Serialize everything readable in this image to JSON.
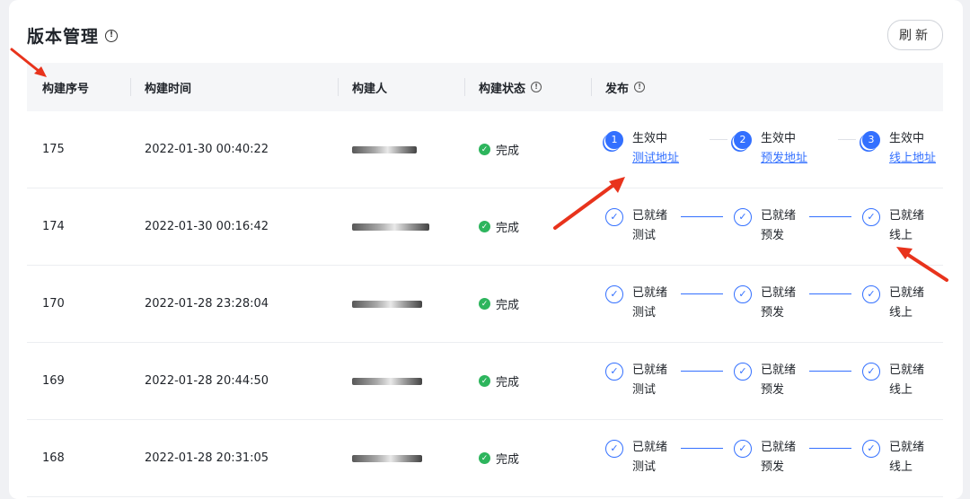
{
  "header": {
    "title": "版本管理",
    "refresh_label": "刷新"
  },
  "columns": [
    "构建序号",
    "构建时间",
    "构建人",
    "构建状态",
    "发布"
  ],
  "rows": [
    {
      "seq": "175",
      "time": "2022-01-30 00:40:22",
      "status": "完成",
      "steps": [
        {
          "num": "1",
          "title": "生效中",
          "link": "测试地址"
        },
        {
          "num": "2",
          "title": "生效中",
          "link": "预发地址"
        },
        {
          "num": "3",
          "title": "生效中",
          "link": "线上地址"
        }
      ]
    },
    {
      "seq": "174",
      "time": "2022-01-30 00:16:42",
      "status": "完成",
      "steps": [
        {
          "title": "已就绪",
          "sub": "测试"
        },
        {
          "title": "已就绪",
          "sub": "预发"
        },
        {
          "title": "已就绪",
          "sub": "线上"
        }
      ]
    },
    {
      "seq": "170",
      "time": "2022-01-28 23:28:04",
      "status": "完成",
      "steps": [
        {
          "title": "已就绪",
          "sub": "测试"
        },
        {
          "title": "已就绪",
          "sub": "预发"
        },
        {
          "title": "已就绪",
          "sub": "线上"
        }
      ]
    },
    {
      "seq": "169",
      "time": "2022-01-28 20:44:50",
      "status": "完成",
      "steps": [
        {
          "title": "已就绪",
          "sub": "测试"
        },
        {
          "title": "已就绪",
          "sub": "预发"
        },
        {
          "title": "已就绪",
          "sub": "线上"
        }
      ]
    },
    {
      "seq": "168",
      "time": "2022-01-28 20:31:05",
      "status": "完成",
      "steps": [
        {
          "title": "已就绪",
          "sub": "测试"
        },
        {
          "title": "已就绪",
          "sub": "预发"
        },
        {
          "title": "已就绪",
          "sub": "线上"
        }
      ]
    }
  ],
  "colors": {
    "accent": "#3370ff",
    "success": "#2db55d",
    "annotation_arrow": "#e8331c"
  }
}
